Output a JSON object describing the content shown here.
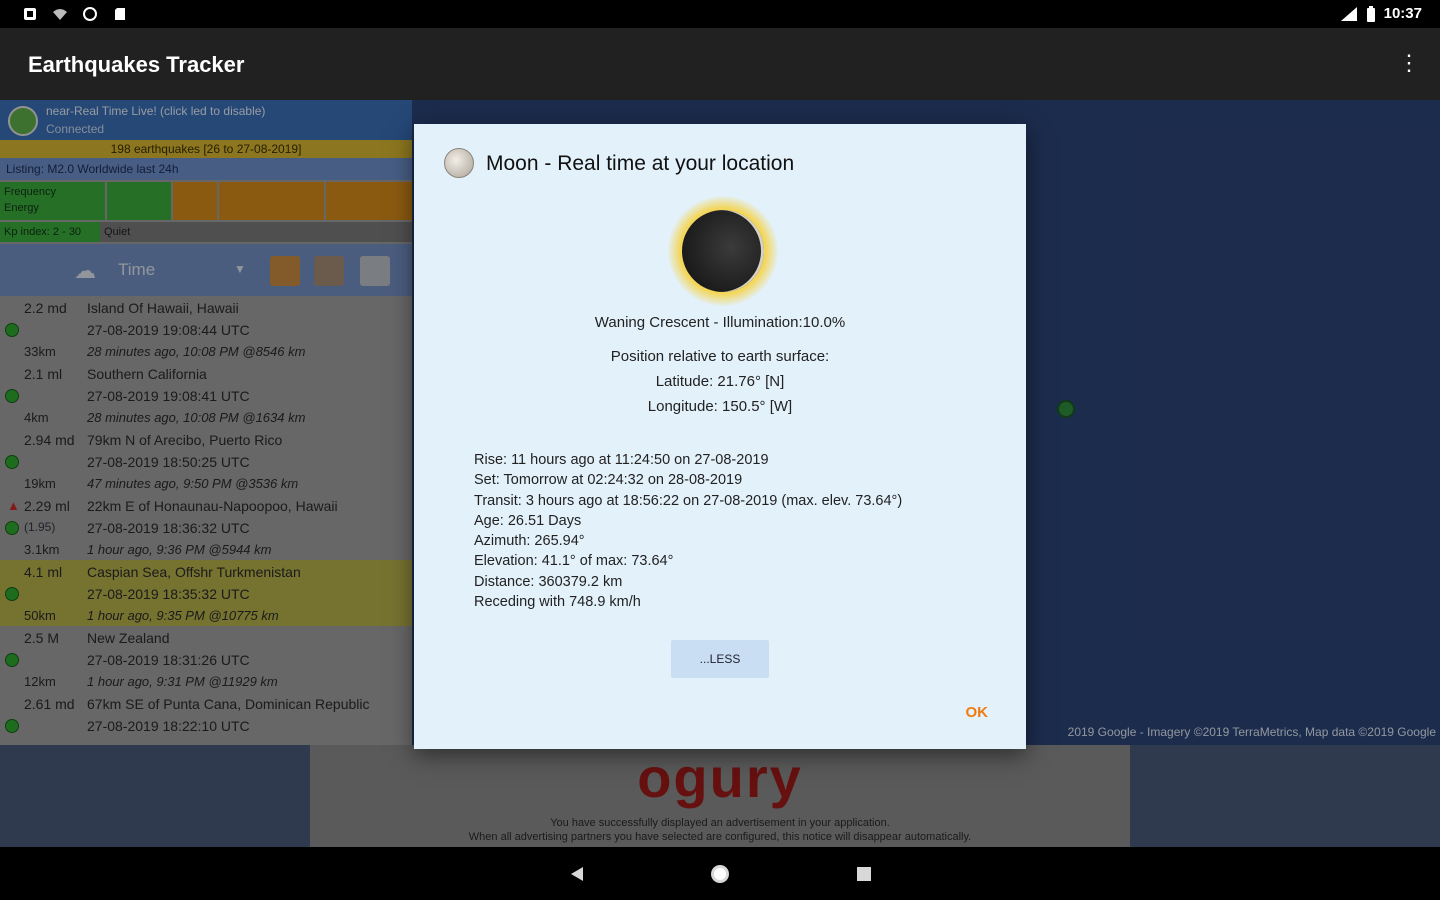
{
  "status_bar": {
    "icons": [
      "notification-icon",
      "wifi-icon",
      "sync-icon",
      "sd-card-icon"
    ],
    "time": "10:37"
  },
  "app_bar": {
    "title": "Earthquakes Tracker"
  },
  "left_panel": {
    "live_title": "near-Real Time Live! (click led to disable)",
    "live_status": "Connected",
    "count": "198 earthquakes [26 to 27-08-2019]",
    "listing": "Listing: M2.0 Worldwide last 24h",
    "freq_label": "Frequency",
    "energy_label": "Energy",
    "kp_label": "Kp index: 2 - 30",
    "kp_status": "Quiet",
    "sort_label": "Time",
    "quakes": [
      {
        "mag": "2.2 md",
        "place": "Island Of Hawaii, Hawaii",
        "time": "27-08-2019 19:08:44 UTC",
        "depth": "33km",
        "ago": "28 minutes ago, 10:08 PM @8546 km"
      },
      {
        "mag": "2.1 ml",
        "place": "Southern California",
        "time": "27-08-2019 19:08:41 UTC",
        "depth": "4km",
        "ago": "28 minutes ago, 10:08 PM @1634 km"
      },
      {
        "mag": "2.94 md",
        "place": "79km N of Arecibo, Puerto Rico",
        "time": "27-08-2019 18:50:25 UTC",
        "depth": "19km",
        "ago": "47 minutes ago, 9:50 PM @3536 km"
      },
      {
        "mag": "2.29 ml",
        "prev": "(1.95)",
        "place": "22km E of Honaunau-Napoopoo, Hawaii",
        "time": "27-08-2019 18:36:32 UTC",
        "depth": "3.1km",
        "ago": "1 hour ago, 9:36 PM @5944 km"
      },
      {
        "mag": "4.1 ml",
        "place": "Caspian Sea, Offshr Turkmenistan",
        "time": "27-08-2019 18:35:32 UTC",
        "depth": "50km",
        "ago": "1 hour ago, 9:35 PM @10775 km"
      },
      {
        "mag": "2.5 M",
        "place": "New Zealand",
        "time": "27-08-2019 18:31:26 UTC",
        "depth": "12km",
        "ago": "1 hour ago, 9:31 PM @11929 km"
      },
      {
        "mag": "2.61 md",
        "place": "67km SE of Punta Cana, Dominican Republic",
        "time": "27-08-2019 18:22:10 UTC"
      }
    ]
  },
  "map": {
    "copyright": "2019 Google - Imagery ©2019 TerraMetrics, Map data ©2019 Google"
  },
  "ad": {
    "logo": "ogury",
    "line1": "You have successfully displayed an advertisement in your application.",
    "line2": "When all advertising partners you have selected are configured, this notice will disappear automatically."
  },
  "dialog": {
    "title": "Moon - Real time at your location",
    "phase": "Waning Crescent - Illumination:10.0%",
    "position_header": "Position relative to earth surface:",
    "latitude": "Latitude: 21.76° [N]",
    "longitude": "Longitude: 150.5° [W]",
    "details": [
      "Rise: 11 hours ago at 11:24:50 on 27-08-2019",
      "Set: Tomorrow at 02:24:32 on 28-08-2019",
      "Transit: 3 hours ago at 18:56:22 on 27-08-2019 (max. elev. 73.64°)",
      "Age: 26.51 Days",
      "Azimuth: 265.94°",
      "Elevation: 41.1° of max: 73.64°",
      "Distance: 360379.2 km",
      "Receding with 748.9 km/h"
    ],
    "less_button": "...LESS",
    "ok_button": "OK"
  },
  "colors": {
    "dialog_bg": "#e3f1fb",
    "ok_accent": "#f07a10",
    "highlight_row": "#b5b04a",
    "map_water": "#2c4477"
  }
}
